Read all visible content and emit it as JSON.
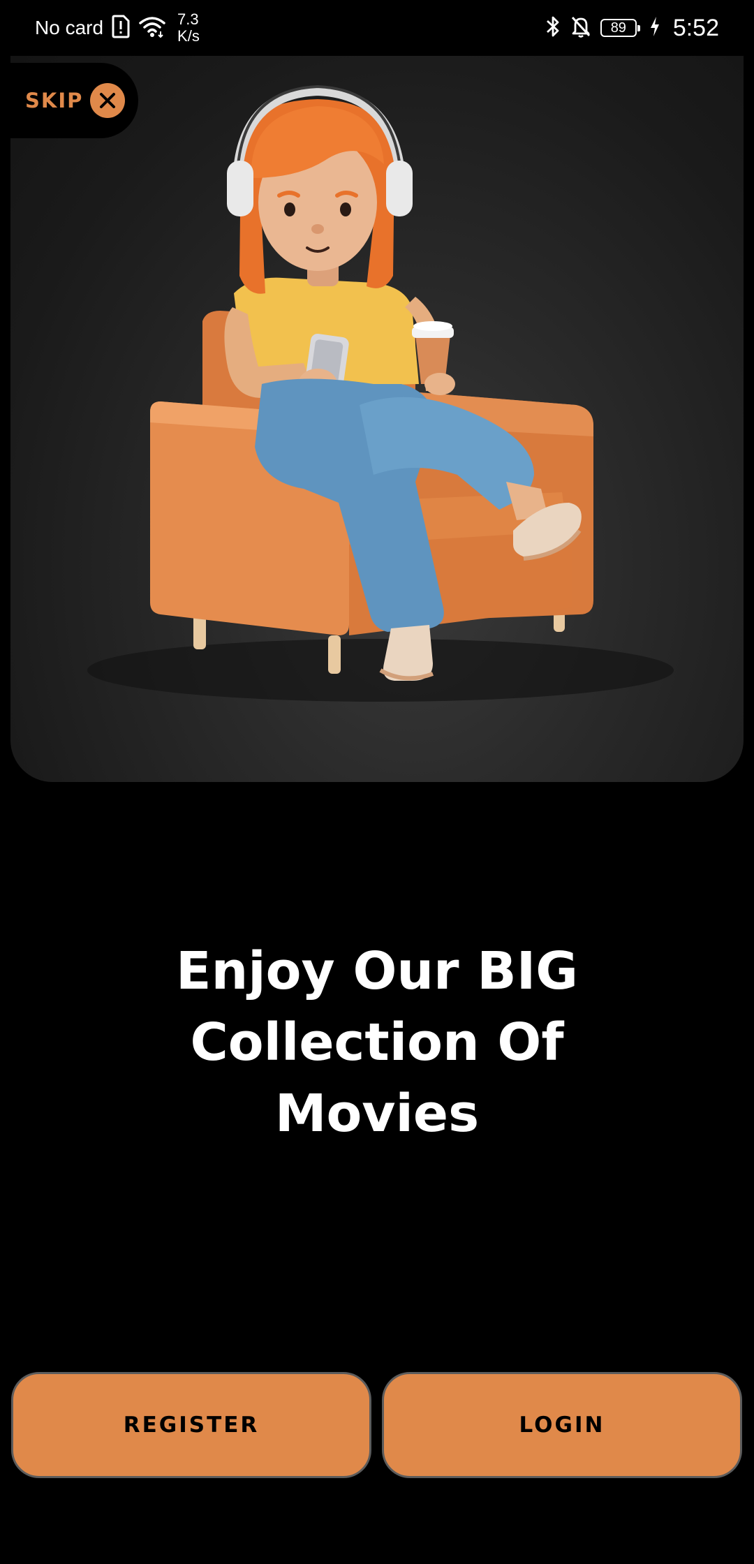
{
  "status_bar": {
    "carrier": "No card",
    "speed_value": "7.3",
    "speed_unit": "K/s",
    "battery": "89",
    "time": "5:52"
  },
  "skip": {
    "label": "SKIP"
  },
  "hero": {
    "illustration": "woman-in-armchair-with-headphones"
  },
  "headline": {
    "line1": "Enjoy Our BIG Collection Of",
    "line2": "Movies"
  },
  "actions": {
    "register_label": "REGISTER",
    "login_label": "LOGIN"
  },
  "colors": {
    "accent": "#e0894a",
    "background": "#000000"
  }
}
